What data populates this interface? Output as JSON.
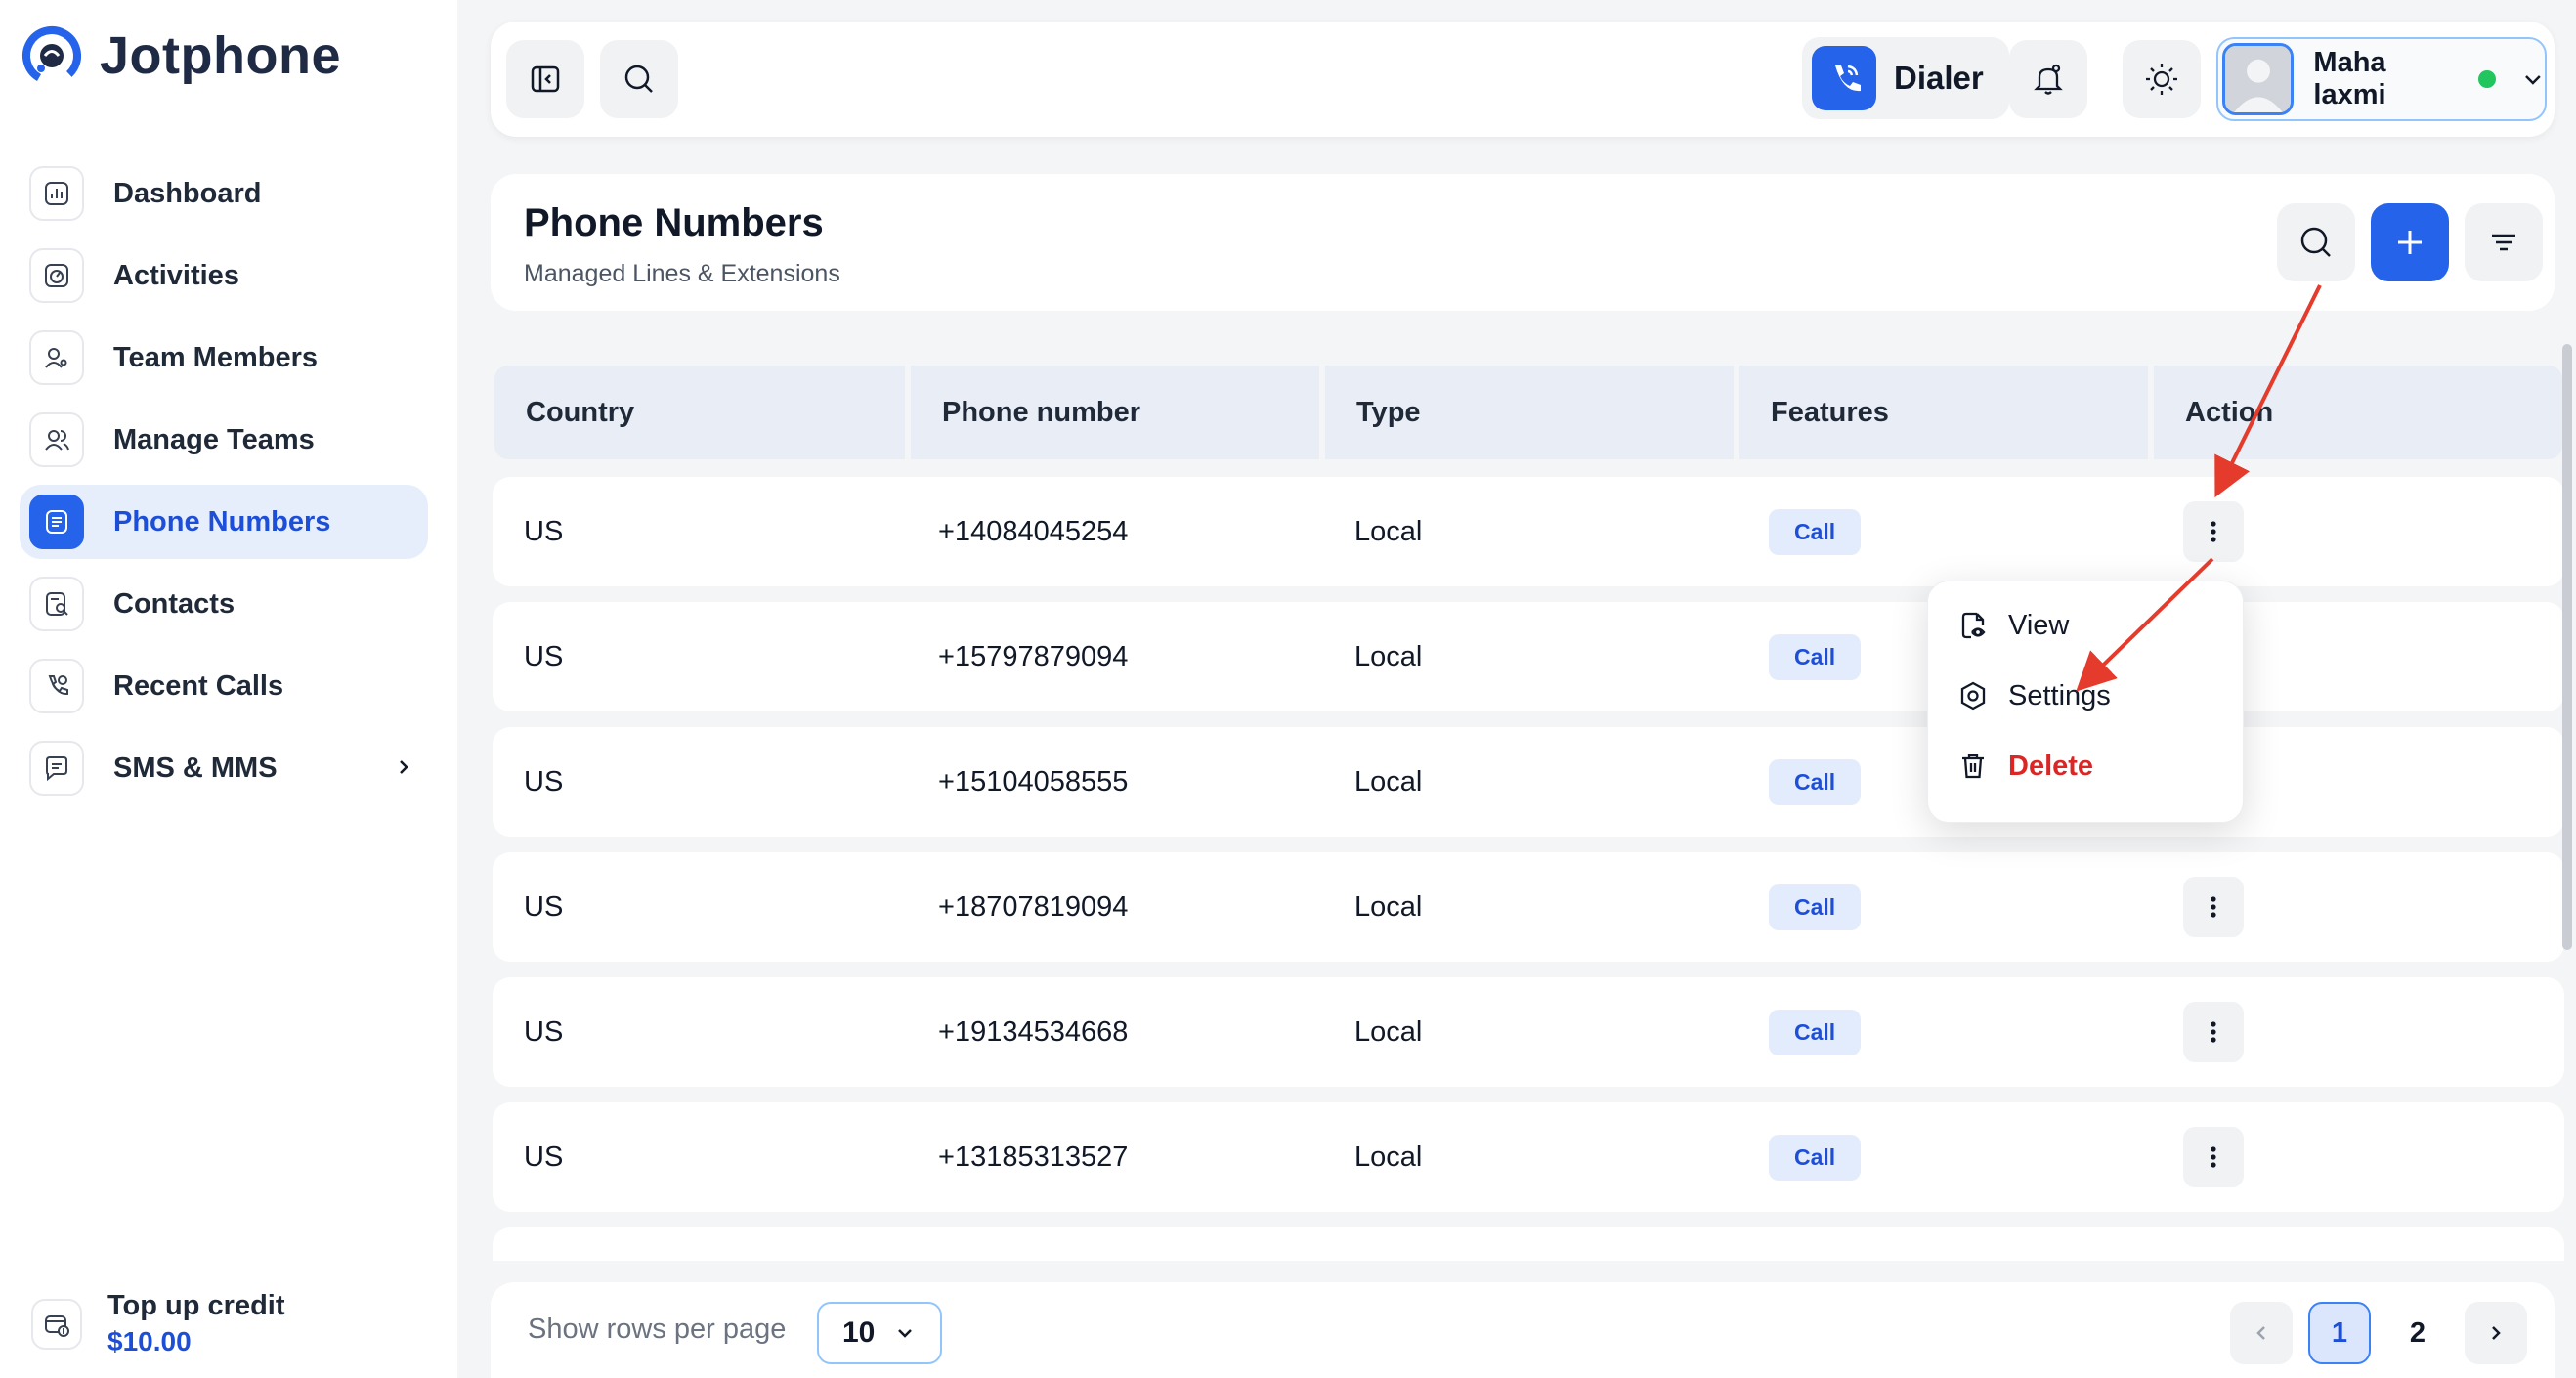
{
  "app": {
    "name": "Jotphone"
  },
  "sidebar": {
    "items": [
      {
        "label": "Dashboard",
        "icon": "chart-icon",
        "active": false
      },
      {
        "label": "Activities",
        "icon": "activity-icon",
        "active": false
      },
      {
        "label": "Team Members",
        "icon": "team-members-icon",
        "active": false
      },
      {
        "label": "Manage Teams",
        "icon": "manage-teams-icon",
        "active": false
      },
      {
        "label": "Phone Numbers",
        "icon": "phone-list-icon",
        "active": true
      },
      {
        "label": "Contacts",
        "icon": "contacts-icon",
        "active": false
      },
      {
        "label": "Recent Calls",
        "icon": "recent-calls-icon",
        "active": false
      },
      {
        "label": "SMS & MMS",
        "icon": "message-icon",
        "active": false,
        "has_submenu": true
      }
    ],
    "topup": {
      "label": "Top up credit",
      "value": "$10.00"
    }
  },
  "header": {
    "dialer_label": "Dialer",
    "user": {
      "name": "Maha laxmi",
      "status": "online"
    }
  },
  "page": {
    "title": "Phone Numbers",
    "subtitle": "Managed Lines & Extensions"
  },
  "table": {
    "columns": [
      "Country",
      "Phone number",
      "Type",
      "Features",
      "Action"
    ],
    "rows": [
      {
        "country": "US",
        "phone": "+14084045254",
        "type": "Local",
        "feature": "Call"
      },
      {
        "country": "US",
        "phone": "+15797879094",
        "type": "Local",
        "feature": "Call"
      },
      {
        "country": "US",
        "phone": "+15104058555",
        "type": "Local",
        "feature": "Call"
      },
      {
        "country": "US",
        "phone": "+18707819094",
        "type": "Local",
        "feature": "Call"
      },
      {
        "country": "US",
        "phone": "+19134534668",
        "type": "Local",
        "feature": "Call"
      },
      {
        "country": "US",
        "phone": "+13185313527",
        "type": "Local",
        "feature": "Call"
      }
    ]
  },
  "action_menu": {
    "items": [
      {
        "label": "View",
        "icon": "view-file-icon"
      },
      {
        "label": "Settings",
        "icon": "settings-icon"
      },
      {
        "label": "Delete",
        "icon": "trash-icon"
      }
    ]
  },
  "footer": {
    "rows_per_page_label": "Show rows per page",
    "rows_per_page_value": "10",
    "pages": [
      "1",
      "2"
    ],
    "current_page": "1"
  },
  "colors": {
    "accent": "#2563eb",
    "active_bg": "#e6edfb",
    "danger": "#dc2626",
    "annotation_arrow": "#e53b2c"
  }
}
